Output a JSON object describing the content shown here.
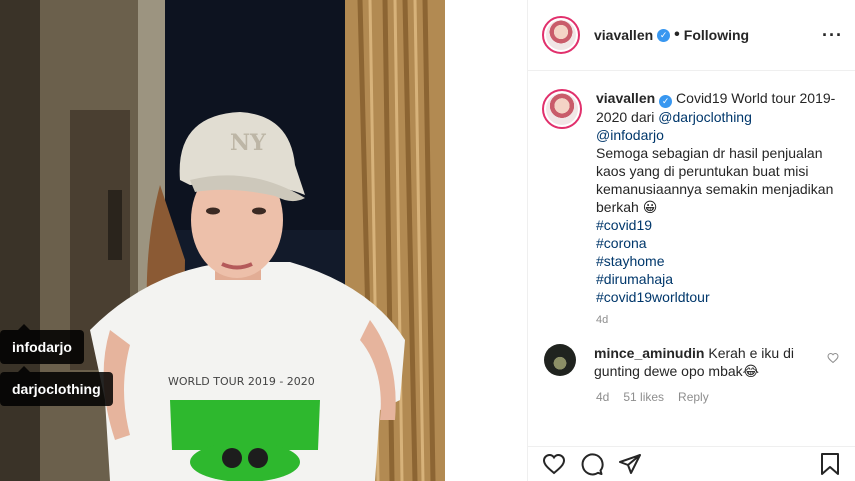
{
  "photo": {
    "tags": [
      "infodarjo",
      "darjoclothing"
    ]
  },
  "header": {
    "username": "viavallen",
    "separator": "•",
    "follow_status": "Following",
    "more": "···"
  },
  "caption": {
    "username": "viavallen",
    "text_1": " Covid19 World tour 2019-2020 dari ",
    "mention_1": "@darjoclothing",
    "mention_2": "@infodarjo",
    "text_2": "Semoga sebagian dr hasil penjualan kaos yang di peruntukan buat misi kemanusiaannya semakin menjadikan berkah 😀",
    "hashtags": [
      "#covid19",
      "#corona",
      "#stayhome",
      "#dirumahaja",
      "#covid19worldtour"
    ],
    "age": "4d"
  },
  "comment": {
    "username": "mince_aminudin",
    "text": " Kerah e iku di gunting dewe opo mbak😂",
    "age": "4d",
    "likes": "51 likes",
    "reply": "Reply"
  },
  "icons": {
    "verified": "verified-badge",
    "like": "heart-icon",
    "comment": "comment-icon",
    "share": "share-icon",
    "save": "bookmark-icon"
  },
  "colors": {
    "link": "#00376b",
    "verified": "#3897f0",
    "shirt_print": "#2eb82e"
  }
}
